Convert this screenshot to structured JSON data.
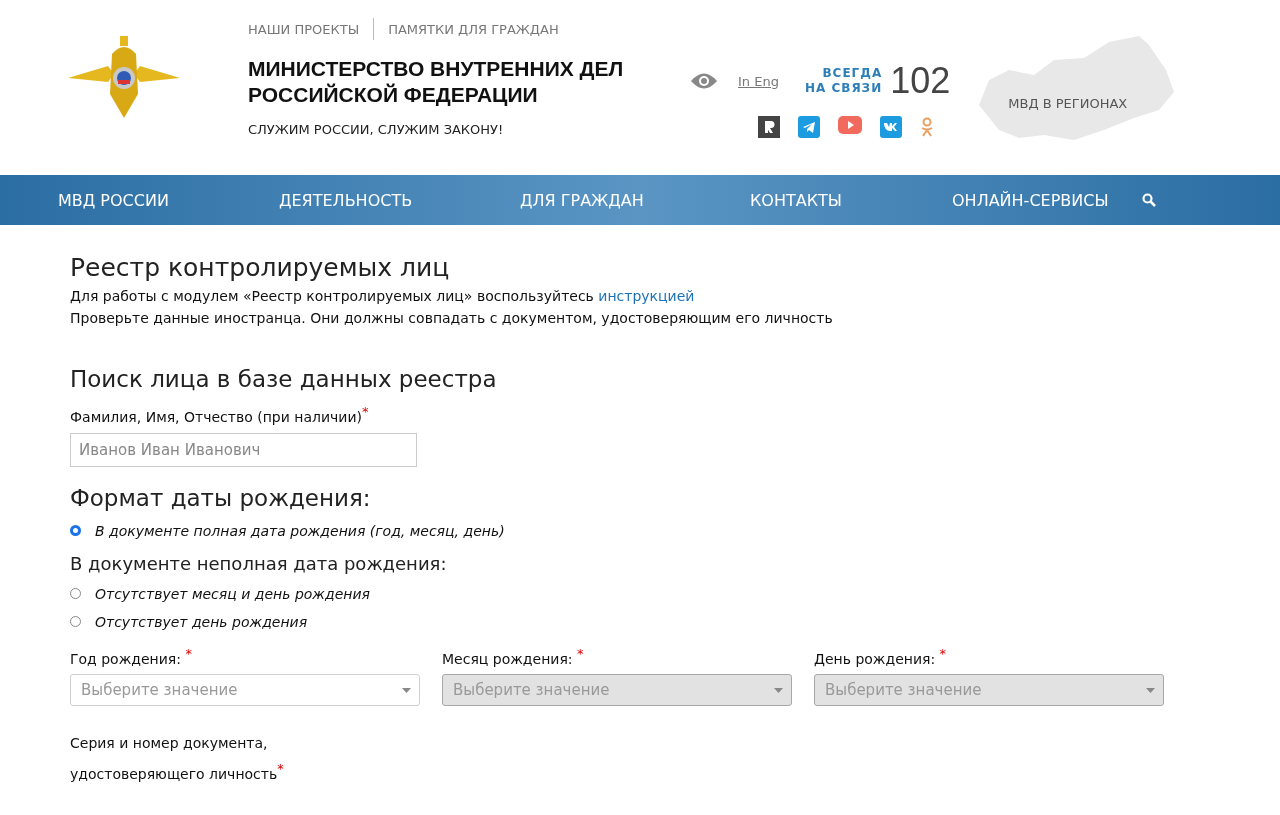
{
  "header": {
    "top_links": [
      "НАШИ ПРОЕКТЫ",
      "ПАМЯТКИ ДЛЯ ГРАЖДАН"
    ],
    "title": "МИНИСТЕРСТВО ВНУТРЕННИХ ДЕЛ РОССИЙСКОЙ ФЕДЕРАЦИИ",
    "slogan": "СЛУЖИМ РОССИИ, СЛУЖИМ ЗАКОНУ!",
    "lang_link": "In Eng",
    "hotline_label": [
      "ВСЕГДА",
      "НА СВЯЗИ"
    ],
    "hotline_number": "102",
    "socials": [
      {
        "kind": "rutube"
      },
      {
        "kind": "telegram"
      },
      {
        "kind": "youtube"
      },
      {
        "kind": "vk"
      },
      {
        "kind": "ok"
      }
    ],
    "regions_label": "МВД В РЕГИОНАХ"
  },
  "nav": {
    "items": [
      "МВД РОССИИ",
      "ДЕЯТЕЛЬНОСТЬ",
      "ДЛЯ ГРАЖДАН",
      "КОНТАКТЫ",
      "ОНЛАЙН-СЕРВИСЫ"
    ]
  },
  "page": {
    "title": "Реестр контролируемых лиц",
    "intro": "Для работы с модулем «Реестр контролируемых лиц» воспользуйтесь",
    "intro_link": "инструкцией",
    "note": "Проверьте данные иностранца. Они должны совпадать с документом, удостоверяющим его личность"
  },
  "search": {
    "title": "Поиск лица в базе данных реестра",
    "name_label": "Фамилия, Имя, Отчество (при наличии)",
    "required_mark": "*",
    "name_placeholder": "Иванов Иван Иванович"
  },
  "date_format": {
    "title": "Формат даты рождения:",
    "options": [
      {
        "label": "В документе полная дата рождения (год, месяц, день)",
        "selected": true
      },
      {
        "kind": "heading",
        "label": "В документе неполная дата рождения:"
      },
      {
        "label": "Отсутствует месяц и день рождения",
        "selected": false
      },
      {
        "label": "Отсутствует день рождения",
        "selected": false
      }
    ]
  },
  "date_fields": [
    {
      "label": "Год рождения:",
      "required_mark": "*",
      "placeholder": "Выберите значение",
      "disabled": false
    },
    {
      "label": "Месяц рождения:",
      "required_mark": "*",
      "placeholder": "Выберите значение",
      "disabled": true
    },
    {
      "label": "День рождения:",
      "required_mark": "*",
      "placeholder": "Выберите значение",
      "disabled": true
    }
  ],
  "document": {
    "label_lines": [
      "Серия и номер документа,",
      "удостоверяющего личность"
    ],
    "required_mark": "*"
  }
}
